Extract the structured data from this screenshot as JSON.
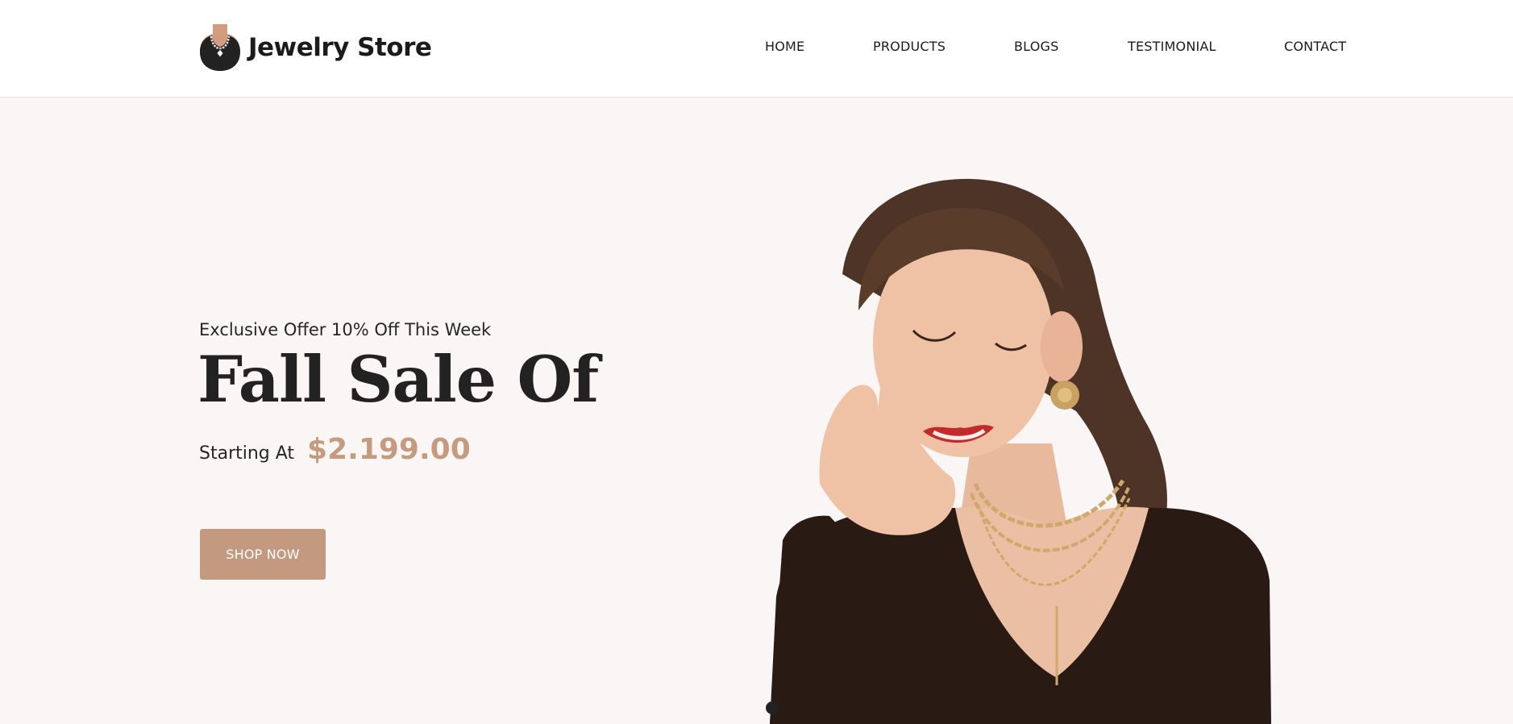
{
  "brand": {
    "name": "Jewelry Store",
    "icon": "necklace-bust-icon",
    "accent_color": "#c39a80"
  },
  "nav": {
    "items": [
      {
        "label": "HOME"
      },
      {
        "label": "PRODUCTS"
      },
      {
        "label": "BLOGS"
      },
      {
        "label": "TESTIMONIAL"
      },
      {
        "label": "CONTACT"
      }
    ]
  },
  "hero": {
    "offer_text": "Exclusive Offer 10% Off This Week",
    "headline": "Fall Sale Of",
    "price_label": "Starting At",
    "price_value": "$2.199.00",
    "price_color": "#c59b7f",
    "cta_label": "SHOP NOW",
    "image": "woman-wearing-gold-necklaces-image",
    "slider": {
      "total_slides": 1,
      "active_slide": 1
    }
  }
}
